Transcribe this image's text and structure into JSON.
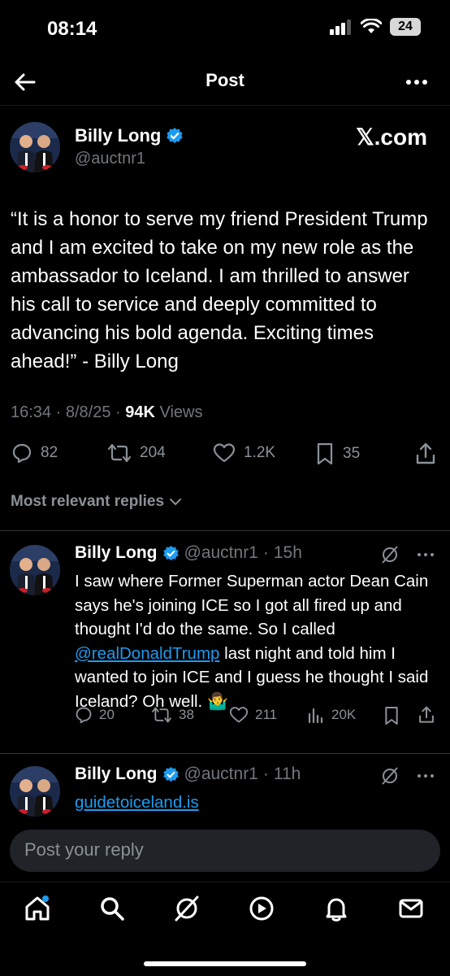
{
  "status_bar": {
    "time": "08:14",
    "battery": "24"
  },
  "header": {
    "title": "Post"
  },
  "post": {
    "author_name": "Billy Long",
    "author_handle": "@auctnr1",
    "watermark": "𝕏.com",
    "text": "“It is a honor to serve my friend  President Trump and I am excited to take on my new role as the ambassador to Iceland. I am thrilled to answer his call to service and deeply committed to advancing his bold agenda. Exciting times ahead!” - Billy Long",
    "time": "16:34",
    "date": "8/8/25",
    "views_count": "94K",
    "views_label": "Views",
    "replies": "82",
    "reposts": "204",
    "likes": "1.2K",
    "bookmarks": "35"
  },
  "sort_label": "Most relevant replies",
  "replies": [
    {
      "author_name": "Billy Long",
      "handle": "@auctnr1",
      "age": "15h",
      "text_before": "I saw where Former Superman actor Dean Cain says he's joining ICE so I got all fired up and thought I'd do the same. So I called ",
      "mention": "@realDonaldTrump",
      "text_after": " last night and told him I wanted to join ICE and I guess he thought I said Iceland? Oh well. 🤷‍♂️",
      "replies": "20",
      "reposts": "38",
      "likes": "211",
      "views": "20K"
    },
    {
      "author_name": "Billy Long",
      "handle": "@auctnr1",
      "age": "11h",
      "link": "guidetoiceland.is"
    }
  ],
  "reply_box": {
    "placeholder": "Post your reply"
  },
  "nav": [
    "home-icon",
    "search-icon",
    "grok-icon",
    "video-icon",
    "notifications-icon",
    "messages-icon"
  ],
  "colors": {
    "accent": "#1d9bf0",
    "verified": "#1d9bf0",
    "muted": "#71767b"
  }
}
